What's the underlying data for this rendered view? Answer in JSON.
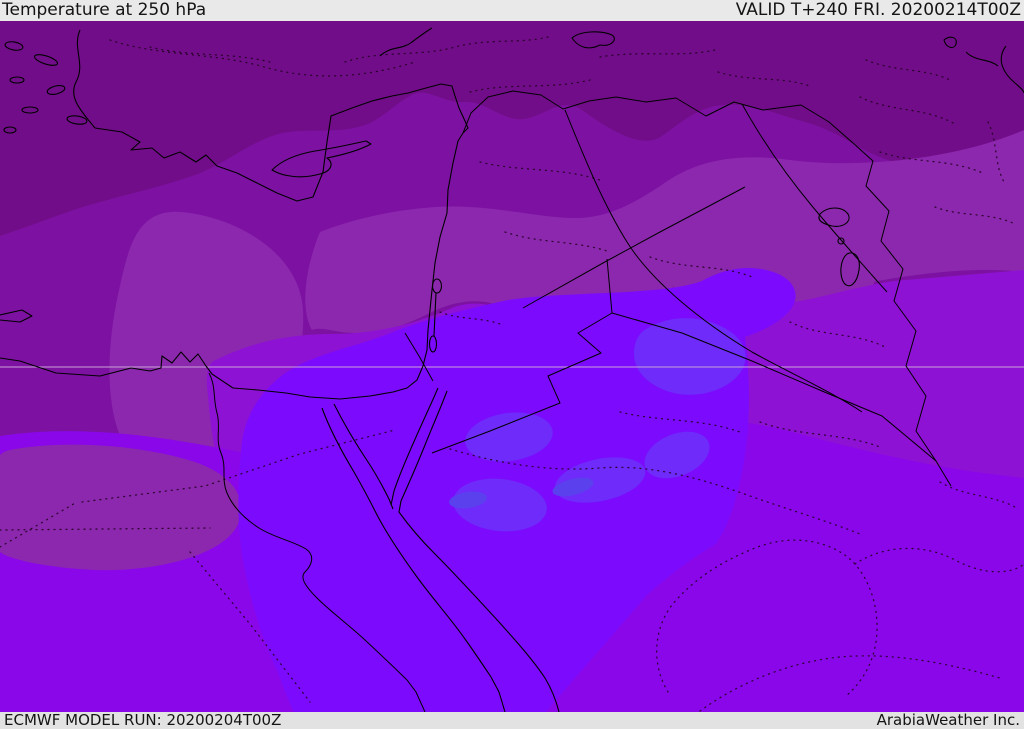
{
  "header": {
    "title": "Temperature at 250 hPa",
    "valid": "VALID T+240 FRI. 20200214T00Z"
  },
  "footer": {
    "model_run": "ECMWF MODEL RUN: 20200204T00Z",
    "credit": "ArabiaWeather Inc."
  },
  "map": {
    "description": "ECMWF 250 hPa temperature forecast shaded in purple-violet bands over the Eastern Mediterranean and Middle East",
    "palette": {
      "header_bg": "#e9e9e9",
      "footer_bg": "#e2e2e2",
      "bar_text": "#141414",
      "band_1_darkest": "#720d89",
      "band_2": "#7d12a2",
      "band_3": "#8c28ae",
      "band_4": "#8e12d4",
      "band_5": "#8a07e9",
      "band_6": "#7c0bfd",
      "band_7": "#6e2bf9",
      "band_8_bluest": "#5b41ee",
      "coastline": "#000000",
      "border": "#000000",
      "river": "#000000",
      "dotted_border": "#20001f",
      "graticule": "#c9a2d6"
    }
  }
}
